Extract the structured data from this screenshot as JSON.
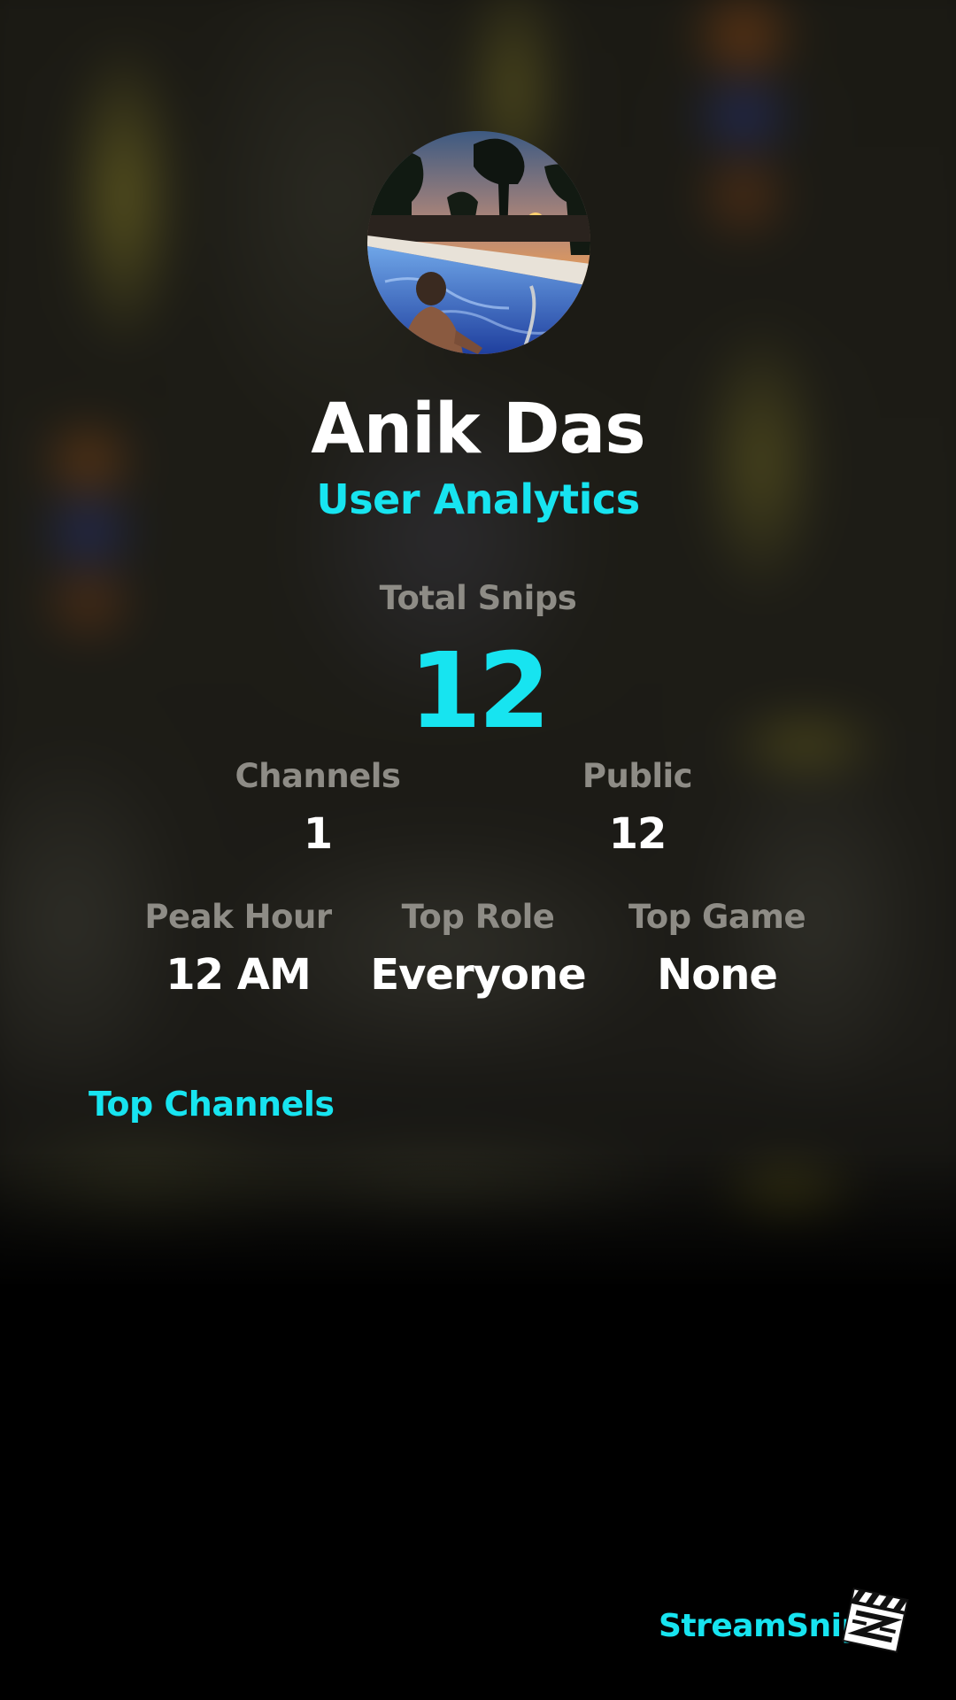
{
  "profile": {
    "name": "Anik Das",
    "subtitle": "User Analytics",
    "avatar_icon": "user-avatar-photo"
  },
  "stats": {
    "total_snips": {
      "label": "Total Snips",
      "value": "12"
    },
    "channels": {
      "label": "Channels",
      "value": "1"
    },
    "public": {
      "label": "Public",
      "value": "12"
    },
    "peak_hour": {
      "label": "Peak Hour",
      "value": "12 AM"
    },
    "top_role": {
      "label": "Top Role",
      "value": "Everyone"
    },
    "top_game": {
      "label": "Top Game",
      "value": "None"
    }
  },
  "sections": {
    "top_channels_title": "Top Channels"
  },
  "brand": {
    "name": "StreamSnip",
    "logo_icon": "clapperboard-icon"
  },
  "colors": {
    "accent": "#17e4f0",
    "label": "#8e8c86",
    "value": "#ffffff",
    "background": "#000000"
  }
}
